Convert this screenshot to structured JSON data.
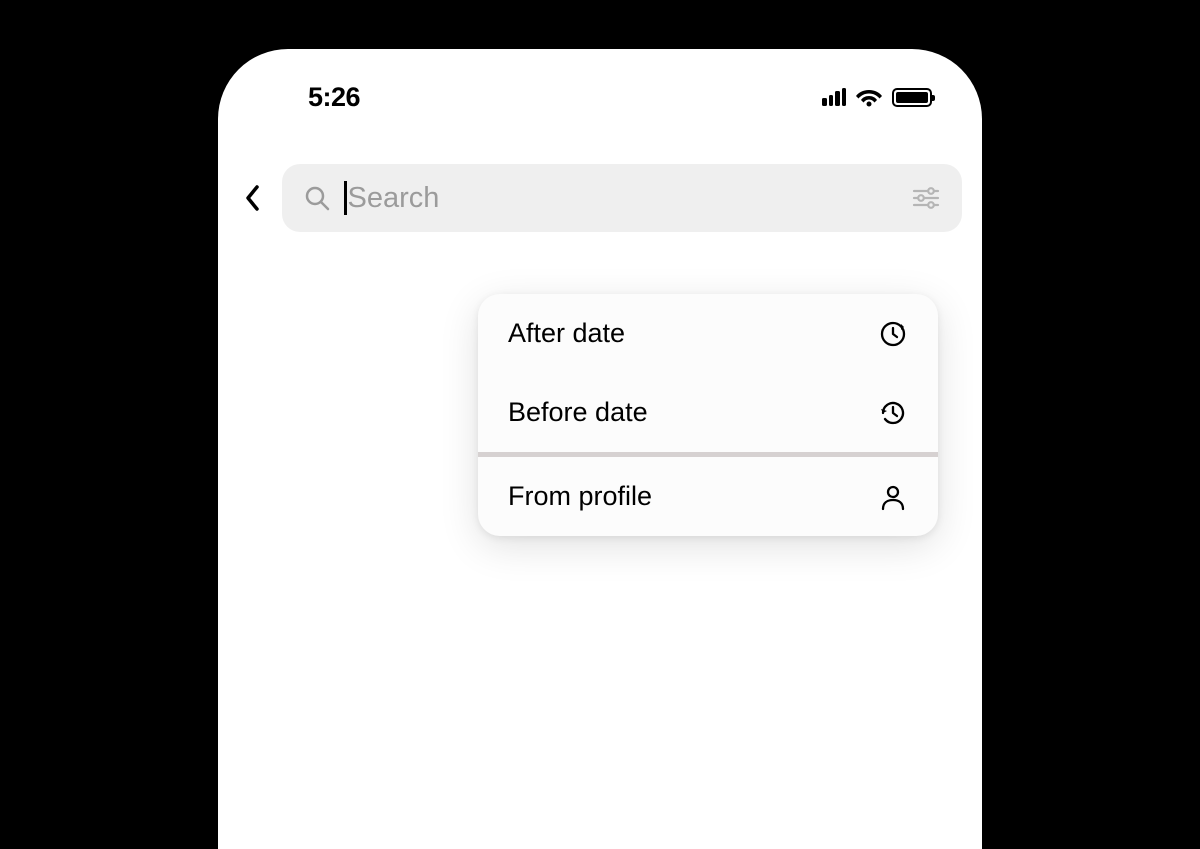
{
  "status_bar": {
    "time": "5:26"
  },
  "search": {
    "placeholder": "Search"
  },
  "dropdown": {
    "items": [
      {
        "label": "After date",
        "icon": "clock-forward"
      },
      {
        "label": "Before date",
        "icon": "clock-backward"
      },
      {
        "label": "From profile",
        "icon": "person"
      }
    ]
  }
}
